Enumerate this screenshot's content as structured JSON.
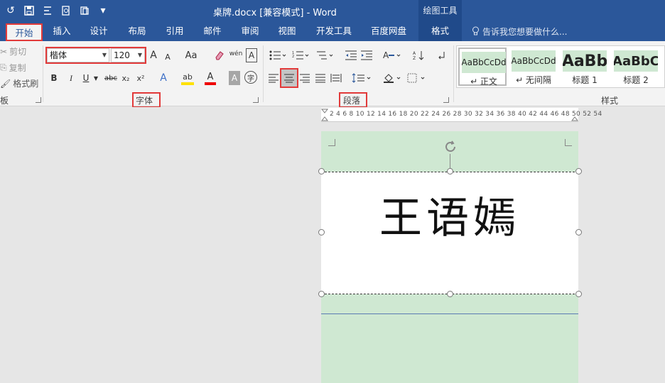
{
  "window": {
    "doc_title": "桌牌.docx [兼容模式] - Word",
    "context_title": "绘图工具"
  },
  "qat": {
    "undo_icon": "↺",
    "save_icon": "save-icon",
    "more_icon": "▾"
  },
  "tabs": [
    {
      "label": "开始",
      "active": true
    },
    {
      "label": "插入"
    },
    {
      "label": "设计"
    },
    {
      "label": "布局"
    },
    {
      "label": "引用"
    },
    {
      "label": "邮件"
    },
    {
      "label": "审阅"
    },
    {
      "label": "视图"
    },
    {
      "label": "开发工具"
    },
    {
      "label": "百度网盘"
    },
    {
      "label": "格式",
      "contextual": true
    }
  ],
  "tellme": {
    "icon": "💡",
    "placeholder": "告诉我您想要做什么..."
  },
  "clipboard": {
    "cut": "剪切",
    "copy": "复制",
    "format_painter": "格式刷",
    "group_label": "板"
  },
  "font": {
    "name": "楷体",
    "size": "120",
    "group_label": "字体",
    "grow": "A",
    "shrink": "A",
    "change_case": "Aa",
    "pinyin": "wén",
    "char_border": "A",
    "bold": "B",
    "italic": "I",
    "underline": "U",
    "strike": "abc",
    "sub": "x₂",
    "sup": "x²",
    "effects": "A",
    "highlight": "ab",
    "color": "A",
    "shading": "A",
    "enclose": "字"
  },
  "paragraph": {
    "group_label": "段落"
  },
  "styles": {
    "group_label": "样式",
    "items": [
      {
        "preview": "AaBbCcDd",
        "name": "↵ 正文"
      },
      {
        "preview": "AaBbCcDd",
        "name": "↵ 无间隔"
      },
      {
        "preview": "AaBb",
        "name": "标题 1"
      },
      {
        "preview": "AaBbC",
        "name": "标题 2"
      }
    ]
  },
  "ruler": {
    "ticks": "2  4  6  8 10 12 14 16 18 20 22 24 26 28 30 32 34 36 38 40 42 44 46 48 50 52 54"
  },
  "document": {
    "nameplate_text": "王语嫣"
  }
}
